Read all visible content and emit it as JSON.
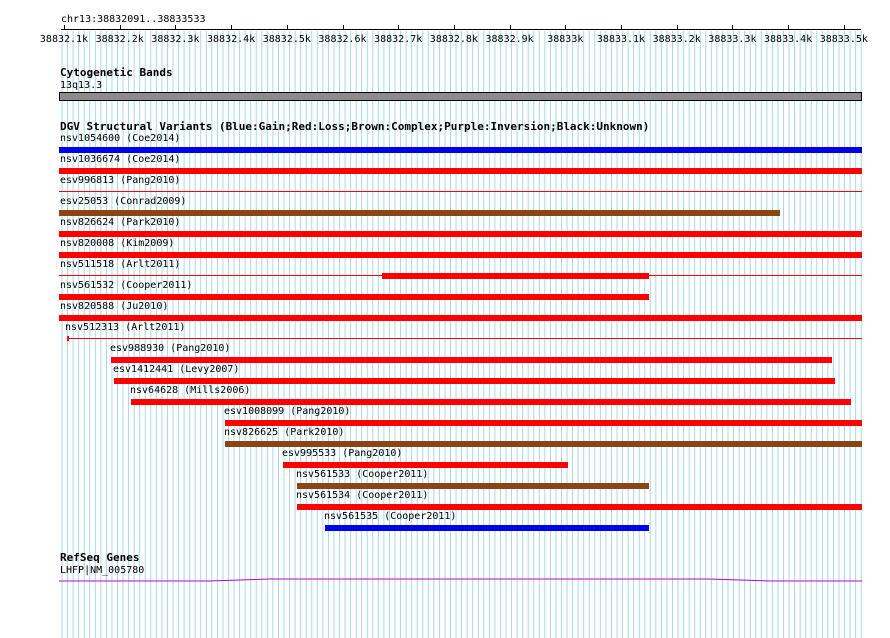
{
  "ruler": {
    "position_label": "chr13:38832091..38833533",
    "ticks": [
      "38832.1k",
      "38832.2k",
      "38832.3k",
      "38832.4k",
      "38832.5k",
      "38832.6k",
      "38832.7k",
      "38832.8k",
      "38832.9k",
      "38833k",
      "38833.1k",
      "38833.2k",
      "38833.3k",
      "38833.4k",
      "38833.5k"
    ]
  },
  "cytoband": {
    "title": "Cytogenetic Bands",
    "band_label": "13q13.3",
    "color": "#8c8c8c"
  },
  "dgv": {
    "title": "DGV Structural Variants (Blue:Gain;Red:Loss;Brown:Complex;Purple:Inversion;Black:Unknown)",
    "colors": {
      "gain": "#0000e6",
      "loss": "#ff0000",
      "complex": "#8b4513",
      "inversion": "#800080",
      "unknown": "#000000"
    },
    "features": [
      {
        "label": "nsv1054600 (Coe2014)",
        "type": "gain"
      },
      {
        "label": "nsv1036674 (Coe2014)",
        "type": "loss"
      },
      {
        "label": "esv996813 (Pang2010)",
        "type": "loss"
      },
      {
        "label": "esv25053 (Conrad2009)",
        "type": "complex"
      },
      {
        "label": "nsv826624 (Park2010)",
        "type": "loss"
      },
      {
        "label": "nsv820008 (Kim2009)",
        "type": "loss"
      },
      {
        "label": "nsv511518 (Arlt2011)",
        "type": "loss"
      },
      {
        "label": "nsv561532 (Cooper2011)",
        "type": "loss"
      },
      {
        "label": "nsv820588 (Ju2010)",
        "type": "loss"
      },
      {
        "label": "nsv512313 (Arlt2011)",
        "type": "loss"
      },
      {
        "label": "esv988930 (Pang2010)",
        "type": "loss"
      },
      {
        "label": "esv1412441 (Levy2007)",
        "type": "loss"
      },
      {
        "label": "nsv64628 (Mills2006)",
        "type": "loss"
      },
      {
        "label": "esv1008099 (Pang2010)",
        "type": "loss"
      },
      {
        "label": "nsv826625 (Park2010)",
        "type": "complex"
      },
      {
        "label": "esv995533 (Pang2010)",
        "type": "loss"
      },
      {
        "label": "nsv561533 (Cooper2011)",
        "type": "complex"
      },
      {
        "label": "nsv561534 (Cooper2011)",
        "type": "loss"
      },
      {
        "label": "nsv561535 (Cooper2011)",
        "type": "gain"
      }
    ]
  },
  "refseq": {
    "title": "RefSeq Genes",
    "gene_label": "LHFP|NM_005780",
    "color": "#c000c0"
  },
  "grid_color": "#a8d8e8"
}
